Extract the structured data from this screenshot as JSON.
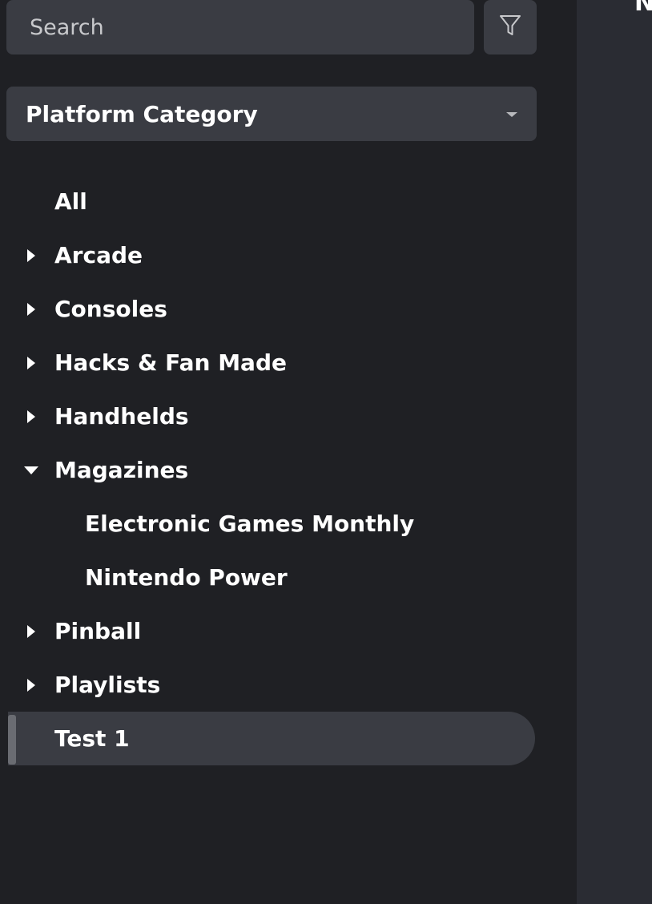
{
  "search": {
    "placeholder": "Search"
  },
  "filter_button": {
    "icon": "filter-funnel-icon"
  },
  "category_select": {
    "selected": "Platform Category"
  },
  "tree": {
    "items": [
      {
        "label": "All",
        "expandable": false,
        "expanded": false,
        "level": 0
      },
      {
        "label": "Arcade",
        "expandable": true,
        "expanded": false,
        "level": 0
      },
      {
        "label": "Consoles",
        "expandable": true,
        "expanded": false,
        "level": 0
      },
      {
        "label": "Hacks & Fan Made",
        "expandable": true,
        "expanded": false,
        "level": 0
      },
      {
        "label": "Handhelds",
        "expandable": true,
        "expanded": false,
        "level": 0
      },
      {
        "label": "Magazines",
        "expandable": true,
        "expanded": true,
        "level": 0
      },
      {
        "label": "Electronic Games Monthly",
        "expandable": false,
        "expanded": false,
        "level": 1
      },
      {
        "label": "Nintendo Power",
        "expandable": false,
        "expanded": false,
        "level": 1
      },
      {
        "label": "Pinball",
        "expandable": true,
        "expanded": false,
        "level": 0
      },
      {
        "label": "Playlists",
        "expandable": true,
        "expanded": false,
        "level": 0
      },
      {
        "label": "Test 1",
        "expandable": false,
        "expanded": false,
        "level": 0,
        "selected": true
      }
    ]
  },
  "right_pane": {
    "clipped_text": "N"
  },
  "colors": {
    "background": "#1f2024",
    "panel": "#3a3c43",
    "right_pane": "#2a2c33",
    "text": "#ffffff"
  }
}
